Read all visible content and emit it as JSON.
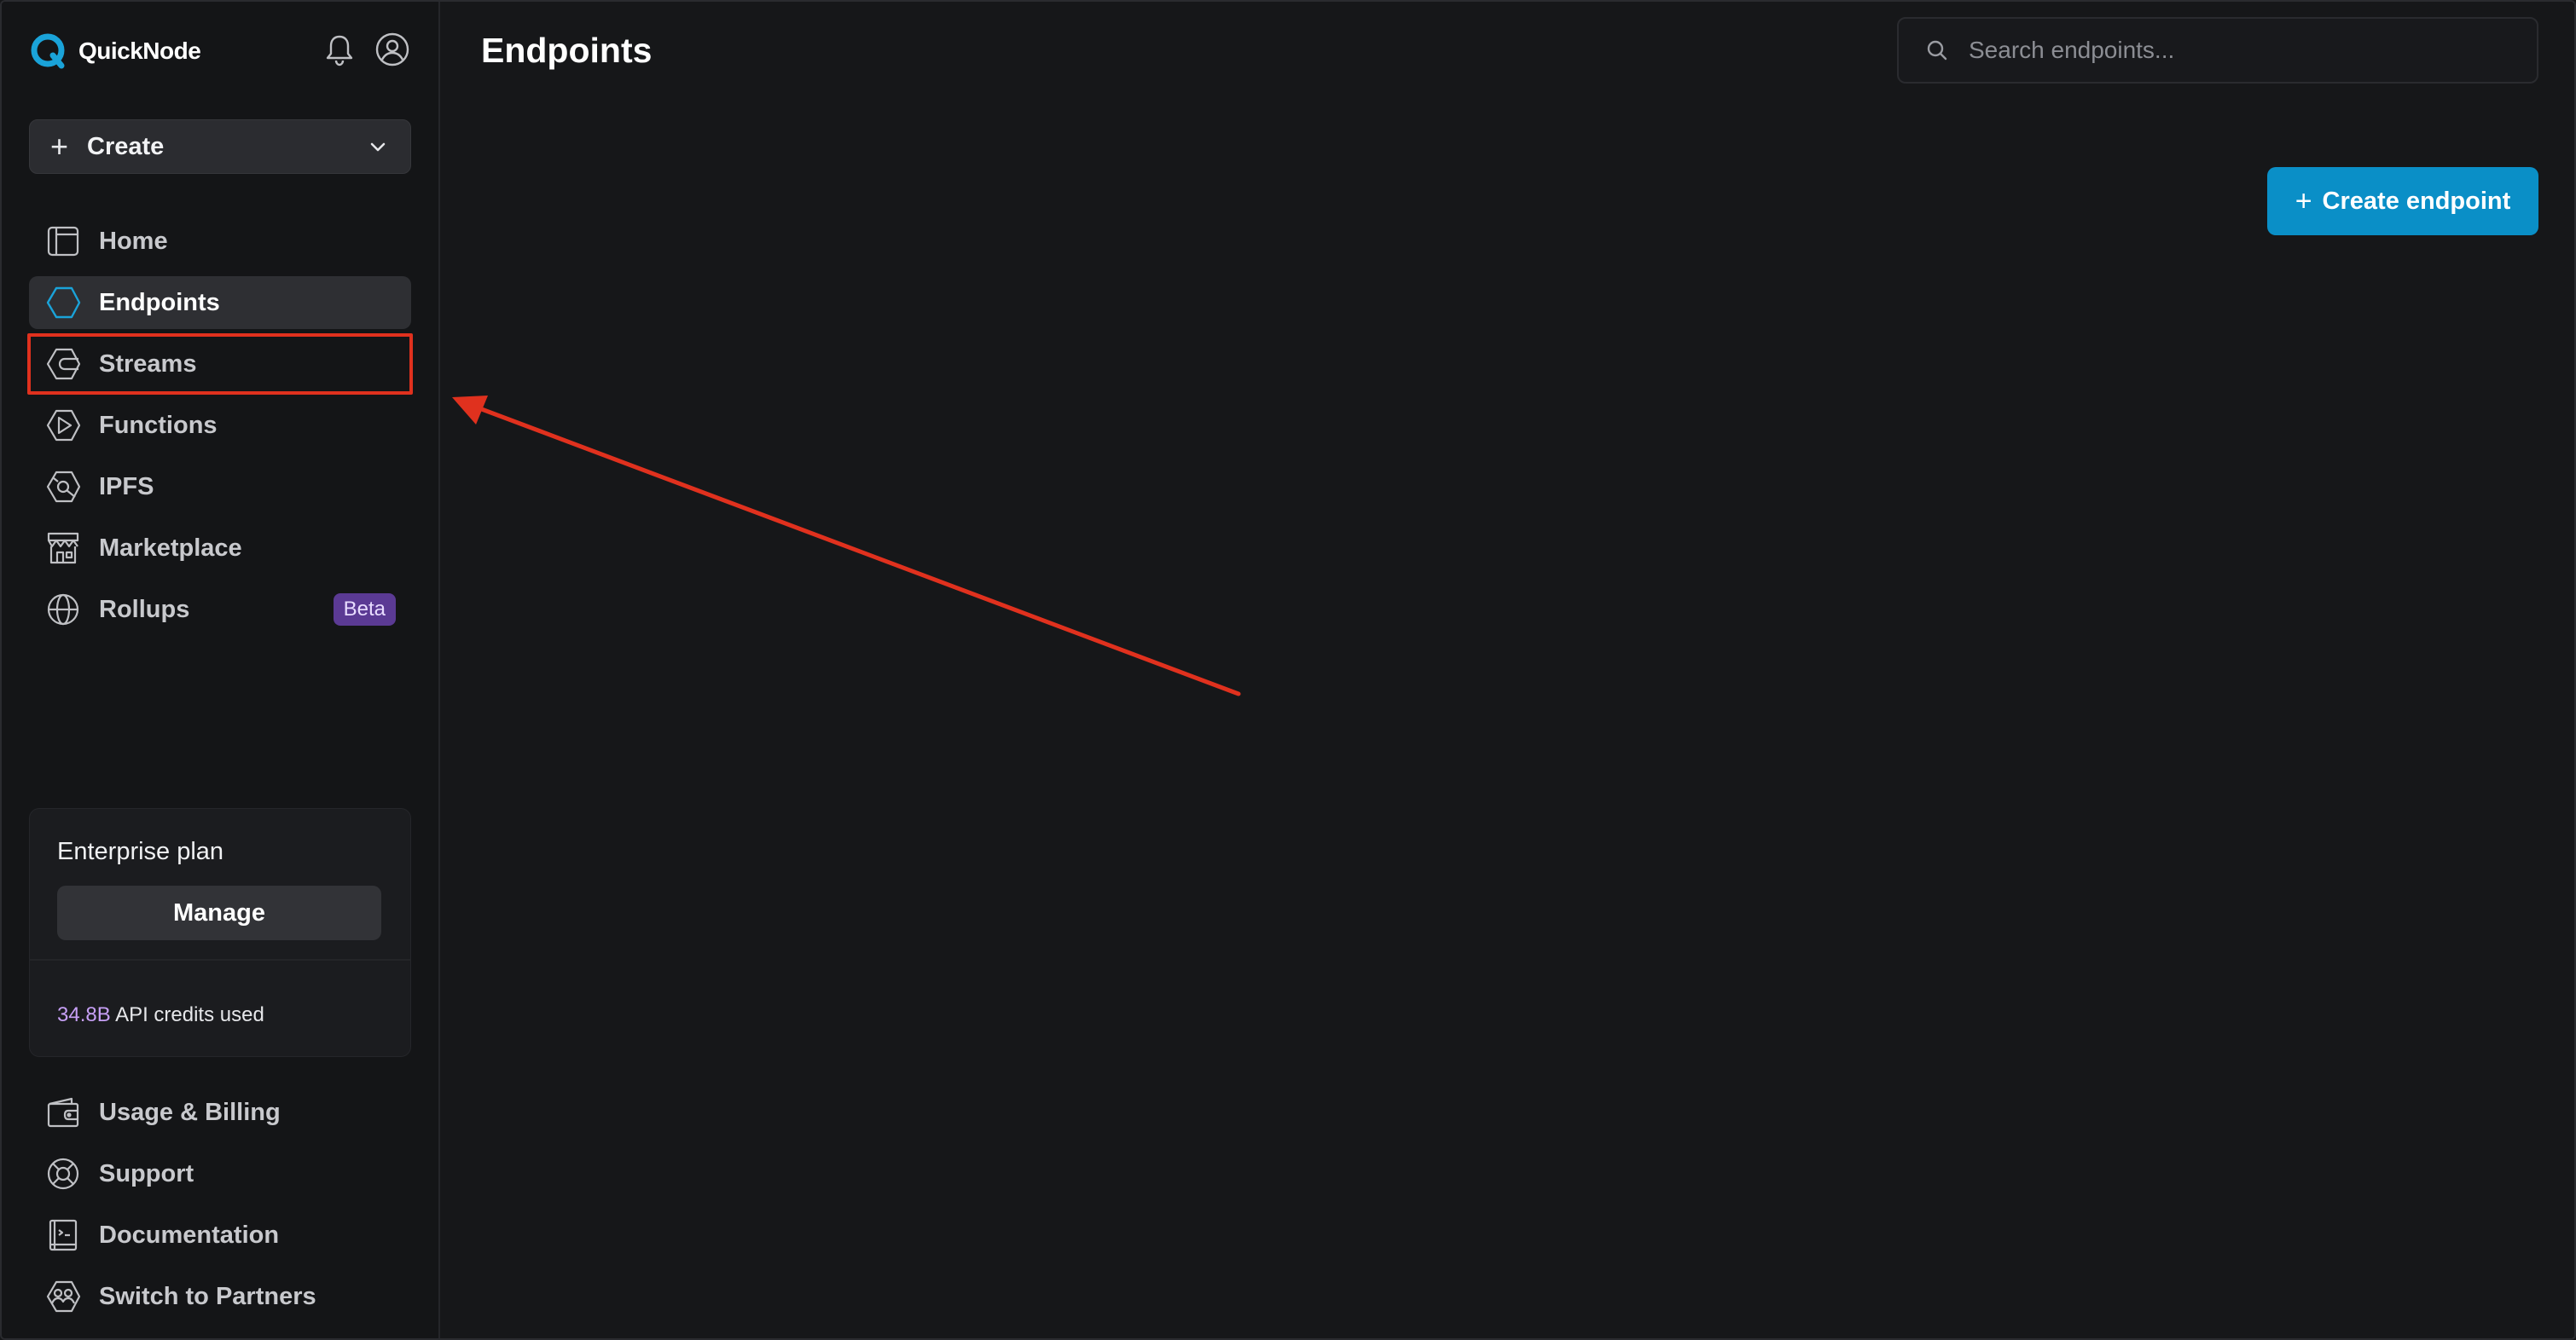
{
  "brand": {
    "name": "QuickNode",
    "accent": "#1aa3d9"
  },
  "header_icons": [
    {
      "icon": "bell-icon",
      "label": "Notifications"
    },
    {
      "icon": "user-icon",
      "label": "Account"
    }
  ],
  "create_menu": {
    "label": "Create",
    "icon": "plus-icon",
    "caret": "chevron-down-icon"
  },
  "nav": {
    "items": [
      {
        "label": "Home",
        "icon": "home-icon"
      },
      {
        "label": "Endpoints",
        "icon": "hexagon-icon",
        "active": true
      },
      {
        "label": "Streams",
        "icon": "streams-icon",
        "highlighted": true
      },
      {
        "label": "Functions",
        "icon": "functions-icon"
      },
      {
        "label": "IPFS",
        "icon": "ipfs-icon"
      },
      {
        "label": "Marketplace",
        "icon": "marketplace-icon"
      },
      {
        "label": "Rollups",
        "icon": "globe-icon",
        "badge": "Beta"
      }
    ]
  },
  "plan": {
    "title": "Enterprise plan",
    "manage_label": "Manage",
    "credits_value": "34.8B",
    "credits_text": "API credits used"
  },
  "bottom_nav": {
    "items": [
      {
        "label": "Usage & Billing",
        "icon": "wallet-icon"
      },
      {
        "label": "Support",
        "icon": "lifebuoy-icon"
      },
      {
        "label": "Documentation",
        "icon": "document-icon"
      },
      {
        "label": "Switch to Partners",
        "icon": "partners-icon"
      }
    ]
  },
  "main": {
    "title": "Endpoints",
    "search": {
      "placeholder": "Search endpoints...",
      "value": ""
    },
    "create_endpoint_label": "Create endpoint"
  },
  "colors": {
    "background": "#161719",
    "sidebar": "#141517",
    "primary_button": "#0a8fc7",
    "highlight": "#e0311e",
    "beta_badge": "#5b3a94",
    "credits_value": "#c7a0f6"
  }
}
